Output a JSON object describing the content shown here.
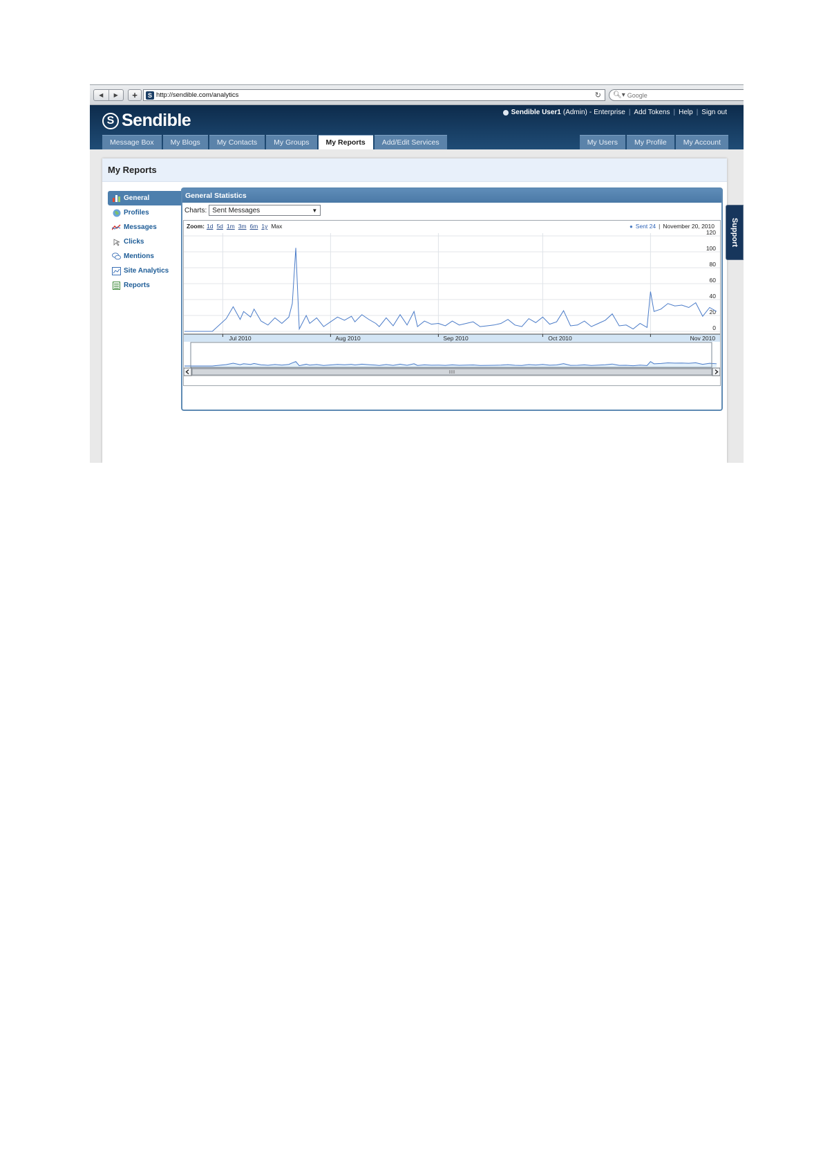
{
  "browser": {
    "url": "http://sendible.com/analytics",
    "search_placeholder": "Google",
    "icons": [
      "back-arrow-icon",
      "forward-arrow-icon",
      "plus-icon",
      "reload-icon",
      "search-icon",
      "page-icon",
      "gear-icon"
    ]
  },
  "app": {
    "logo": "Sendible",
    "user": {
      "name": "Sendible User1",
      "role": "(Admin)",
      "plan": "Enterprise",
      "links": [
        "Add Tokens",
        "Help",
        "Sign out"
      ]
    },
    "tabs_left": [
      "Message Box",
      "My Blogs",
      "My Contacts",
      "My Groups",
      "My Reports",
      "Add/Edit Services"
    ],
    "tabs_right": [
      "My Users",
      "My Profile",
      "My Account"
    ],
    "active_tab": "My Reports"
  },
  "page": {
    "title": "My Reports",
    "nav": [
      {
        "label": "General",
        "icon": "bar-chart-icon",
        "active": true
      },
      {
        "label": "Profiles",
        "icon": "globe-icon",
        "active": false
      },
      {
        "label": "Messages",
        "icon": "line-chart-icon",
        "active": false
      },
      {
        "label": "Clicks",
        "icon": "cursor-icon",
        "active": false
      },
      {
        "label": "Mentions",
        "icon": "speech-bubbles-icon",
        "active": false
      },
      {
        "label": "Site Analytics",
        "icon": "analytics-chart-icon",
        "active": false
      },
      {
        "label": "Reports",
        "icon": "spreadsheet-icon",
        "active": false
      }
    ],
    "panel_title": "General Statistics",
    "charts_label": "Charts:",
    "charts_selected": "Sent Messages",
    "zoom_label": "Zoom:",
    "zoom_options": [
      "1d",
      "5d",
      "1m",
      "3m",
      "6m",
      "1y",
      "Max"
    ],
    "legend_series": "Sent 24",
    "legend_date": "November 20, 2010",
    "support_label": "Support"
  },
  "colors": {
    "header": "#0d2b4b",
    "tab": "#5b83aa",
    "accent": "#4d7fad",
    "line": "#4a7bc8",
    "navigator_fill": "#e4f1fb"
  },
  "chart_data": {
    "type": "line",
    "ylim": [
      0,
      120
    ],
    "yticks": [
      0,
      20,
      40,
      60,
      80,
      100,
      120
    ],
    "xtick_labels": [
      "Jul 2010",
      "Aug 2010",
      "Sep 2010",
      "Oct 2010",
      "Nov 2010"
    ],
    "x_range": [
      "2010-06-20",
      "2010-11-20"
    ],
    "series": [
      {
        "name": "Sent",
        "x": [
          "2010-06-20",
          "2010-06-24",
          "2010-06-28",
          "2010-07-02",
          "2010-07-04",
          "2010-07-06",
          "2010-07-07",
          "2010-07-09",
          "2010-07-10",
          "2010-07-12",
          "2010-07-14",
          "2010-07-16",
          "2010-07-18",
          "2010-07-20",
          "2010-07-21",
          "2010-07-22",
          "2010-07-23",
          "2010-07-25",
          "2010-07-26",
          "2010-07-28",
          "2010-07-30",
          "2010-08-01",
          "2010-08-03",
          "2010-08-05",
          "2010-08-07",
          "2010-08-08",
          "2010-08-10",
          "2010-08-12",
          "2010-08-14",
          "2010-08-15",
          "2010-08-17",
          "2010-08-19",
          "2010-08-21",
          "2010-08-23",
          "2010-08-25",
          "2010-08-26",
          "2010-08-28",
          "2010-08-30",
          "2010-09-01",
          "2010-09-03",
          "2010-09-05",
          "2010-09-07",
          "2010-09-09",
          "2010-09-11",
          "2010-09-13",
          "2010-09-15",
          "2010-09-17",
          "2010-09-19",
          "2010-09-21",
          "2010-09-23",
          "2010-09-25",
          "2010-09-27",
          "2010-09-29",
          "2010-10-01",
          "2010-10-03",
          "2010-10-05",
          "2010-10-07",
          "2010-10-09",
          "2010-10-11",
          "2010-10-13",
          "2010-10-15",
          "2010-10-17",
          "2010-10-19",
          "2010-10-21",
          "2010-10-23",
          "2010-10-25",
          "2010-10-27",
          "2010-10-29",
          "2010-10-31",
          "2010-11-01",
          "2010-11-02",
          "2010-11-04",
          "2010-11-06",
          "2010-11-08",
          "2010-11-10",
          "2010-11-12",
          "2010-11-14",
          "2010-11-16",
          "2010-11-18",
          "2010-11-20"
        ],
        "values": [
          0,
          0,
          0,
          16,
          31,
          15,
          25,
          18,
          28,
          13,
          8,
          17,
          10,
          18,
          35,
          105,
          3,
          20,
          10,
          17,
          6,
          12,
          18,
          14,
          19,
          12,
          21,
          15,
          10,
          6,
          17,
          7,
          21,
          8,
          25,
          6,
          13,
          9,
          10,
          7,
          13,
          8,
          10,
          12,
          6,
          7,
          8,
          10,
          15,
          8,
          6,
          16,
          11,
          18,
          9,
          12,
          26,
          7,
          8,
          13,
          6,
          10,
          14,
          22,
          7,
          8,
          3,
          10,
          5,
          50,
          25,
          28,
          35,
          32,
          33,
          30,
          36,
          19,
          30,
          25
        ]
      }
    ]
  }
}
